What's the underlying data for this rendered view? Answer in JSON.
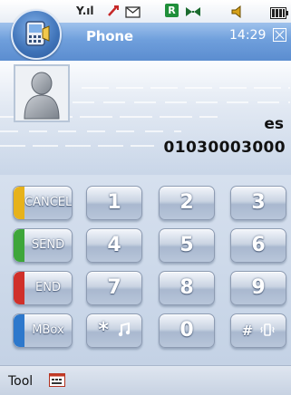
{
  "status": {
    "signal": "Y.ıl",
    "roaming_badge": "R",
    "colors": {
      "battery": "#222222",
      "badge_green": "#1f8f3a"
    }
  },
  "title": {
    "app_name": "Phone",
    "time": "14:29"
  },
  "call": {
    "name": "es",
    "number": "01030003000"
  },
  "keypad": {
    "function_keys": [
      {
        "label": "CANCEL",
        "color": "#e7b21b"
      },
      {
        "label": "SEND",
        "color": "#3ea63a"
      },
      {
        "label": "END",
        "color": "#d0302a"
      },
      {
        "label": "MBox",
        "color": "#2d78cc"
      }
    ],
    "keys": [
      "1",
      "2",
      "3",
      "4",
      "5",
      "6",
      "7",
      "8",
      "9",
      "*",
      "0",
      "#"
    ]
  },
  "toolbar": {
    "label": "Tool"
  }
}
